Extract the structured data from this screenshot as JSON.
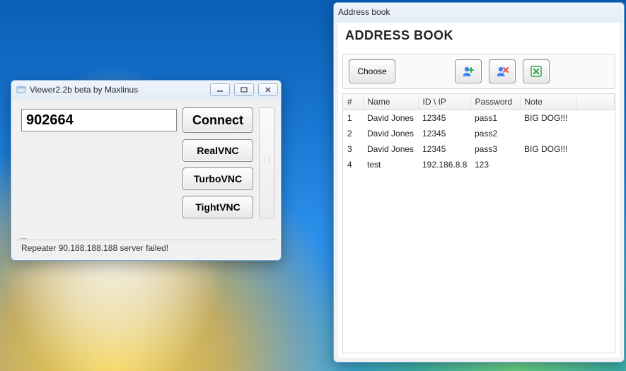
{
  "viewer": {
    "title": "Viewer2.2b beta by Maxlinus",
    "host_value": "902664",
    "buttons": {
      "connect": "Connect",
      "realvnc": "RealVNC",
      "turbovnc": "TurboVNC",
      "tightvnc": "TightVNC"
    },
    "status": "Repeater 90.188.188.188 server failed!"
  },
  "addressbook": {
    "title": "Address book",
    "heading": "ADDRESS BOOK",
    "choose_label": "Choose",
    "columns": {
      "num": "#",
      "name": "Name",
      "id": "ID \\ IP",
      "password": "Password",
      "note": "Note"
    },
    "rows": [
      {
        "n": "1",
        "name": "David Jones",
        "id": "12345",
        "password": "pass1",
        "note": "BIG DOG!!!"
      },
      {
        "n": "2",
        "name": "David Jones",
        "id": "12345",
        "password": "pass2",
        "note": ""
      },
      {
        "n": "3",
        "name": "David Jones",
        "id": "12345",
        "password": "pass3",
        "note": "BIG DOG!!!"
      },
      {
        "n": "4",
        "name": "test",
        "id": "192.186.8.8",
        "password": "123",
        "note": ""
      }
    ]
  }
}
